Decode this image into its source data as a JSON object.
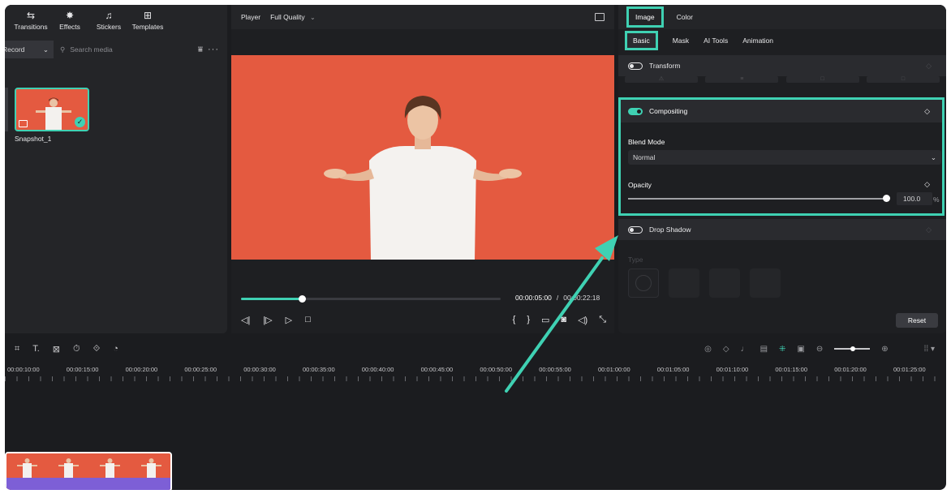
{
  "media": {
    "tabs": [
      {
        "label": "Transitions",
        "icon": "transitions-icon"
      },
      {
        "label": "Effects",
        "icon": "effects-icon"
      },
      {
        "label": "Stickers",
        "icon": "stickers-icon"
      },
      {
        "label": "Templates",
        "icon": "templates-icon"
      }
    ],
    "record_select": "Record",
    "search_placeholder": "Search media",
    "item_label": "Snapshot_1"
  },
  "player": {
    "label": "Player",
    "quality": "Full Quality",
    "progress_fraction": 0.235,
    "current_time": "00:00:05:00",
    "separator": "/",
    "total_time": "00:00:22:18"
  },
  "properties": {
    "tabs_main": [
      "Image",
      "Color"
    ],
    "tabs_sub": [
      "Basic",
      "Mask",
      "AI Tools",
      "Animation"
    ],
    "transform_label": "Transform",
    "compositing_label": "Compositing",
    "blend_mode_label": "Blend Mode",
    "blend_mode_value": "Normal",
    "opacity_label": "Opacity",
    "opacity_value": "100.0",
    "opacity_unit": "%",
    "opacity_fraction": 1.0,
    "drop_shadow_label": "Drop Shadow",
    "type_label": "Type",
    "reset_label": "Reset"
  },
  "timeline": {
    "ruler": [
      "00:00:10:00",
      "00:00:15:00",
      "00:00:20:00",
      "00:00:25:00",
      "00:00:30:00",
      "00:00:35:00",
      "00:00:40:00",
      "00:00:45:00",
      "00:00:50:00",
      "00:00:55:00",
      "00:01:00:00",
      "00:01:05:00",
      "00:01:10:00",
      "00:01:15:00",
      "00:01:20:00",
      "00:01:25:00"
    ]
  },
  "colors": {
    "accent": "#3fd1b3",
    "video_bg": "#e45a40",
    "audio_track": "#7d5fd6"
  }
}
